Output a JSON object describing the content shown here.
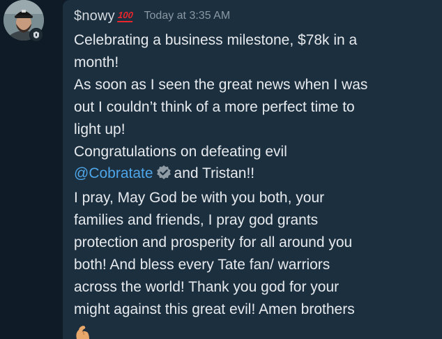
{
  "post": {
    "username": "$nowy",
    "username_emoji": "100",
    "timestamp": "Today at 3:35 AM",
    "lines": {
      "l1": "Celebrating a business milestone, $78k in a",
      "l2": "month!",
      "l3": "As soon as I seen the great news when I was",
      "l4": "out I couldn’t think of a more perfect time to",
      "l5": "light up!",
      "l6": "Congratulations on defeating evil",
      "l7_mention": "@Cobratate",
      "l7_rest": "and Tristan!!",
      "l8": "I pray, May God be with you both, your",
      "l9": "families and friends, I pray god grants",
      "l10": "protection and prosperity for all around you",
      "l11": "both! And bless every Tate fan/ warriors",
      "l12": "across the world! Thank you god for your",
      "l13": "might against this great evil! Amen brothers"
    },
    "trailing_emoji": "muscle-emoji"
  },
  "colors": {
    "background": "#0f1c27",
    "bubble": "#1c2f3e",
    "text": "#e6eaee",
    "muted": "#8a98a4",
    "mention": "#4ea6e8",
    "hundred_emoji": "#e8262c"
  },
  "icons": {
    "verified": "verified-badge-icon",
    "avatar_badge": "rank-badge-icon"
  }
}
